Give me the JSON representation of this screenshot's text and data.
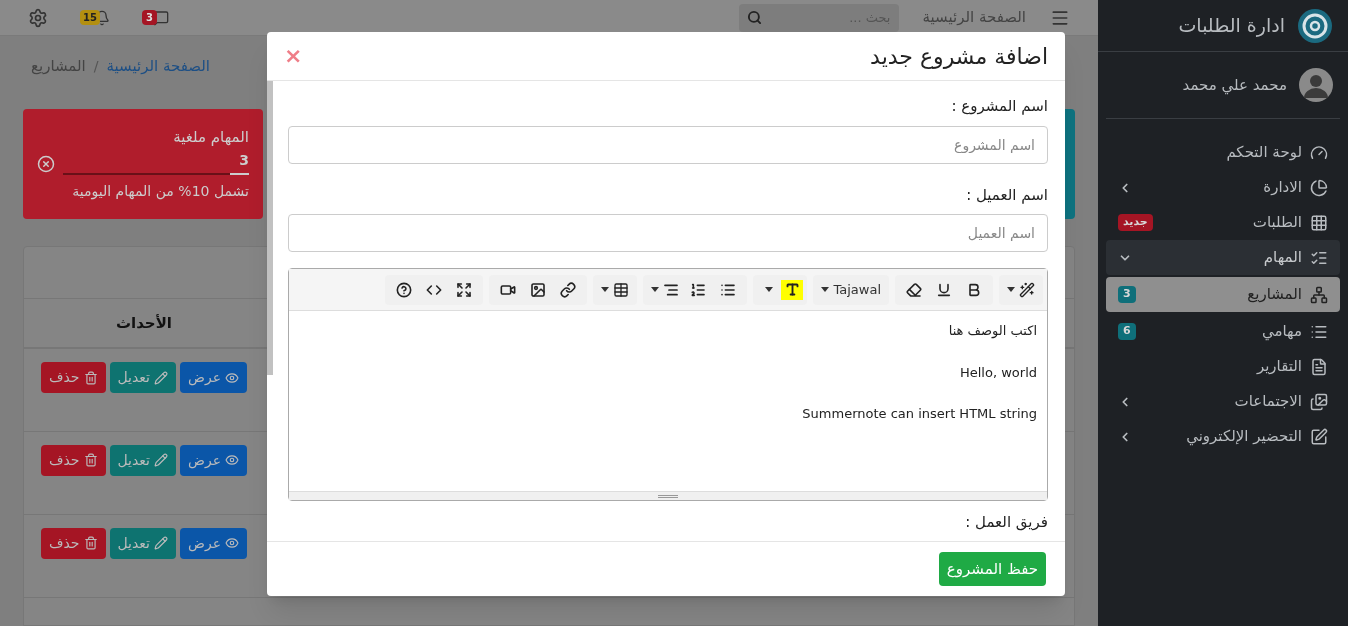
{
  "navbar": {
    "home_link": "الصفحة الرئيسية",
    "search": {
      "placeholder": "بحث ..."
    },
    "messages_count": "3",
    "notifications_count": "15"
  },
  "breadcrumb": {
    "separator": "/",
    "items": [
      {
        "label": "الصفحة الرئيسية",
        "link": true
      },
      {
        "label": "المشاريع",
        "link": false
      }
    ]
  },
  "stat_card": {
    "title": "المهام ملغية",
    "value": "3",
    "level": 0.1,
    "note": "تشمل 10% من المهام اليومية"
  },
  "table": {
    "columns": [
      "الأحداث"
    ],
    "rows": [
      {
        "actions": [
          {
            "kind": "view",
            "label": "عرض"
          },
          {
            "kind": "edit",
            "label": "تعديل"
          },
          {
            "kind": "delete",
            "label": "حذف"
          }
        ]
      },
      {
        "actions": [
          {
            "kind": "view",
            "label": "عرض"
          },
          {
            "kind": "edit",
            "label": "تعديل"
          },
          {
            "kind": "delete",
            "label": "حذف"
          }
        ]
      },
      {
        "actions": [
          {
            "kind": "view",
            "label": "عرض"
          },
          {
            "kind": "edit",
            "label": "تعديل"
          },
          {
            "kind": "delete",
            "label": "حذف"
          }
        ]
      }
    ]
  },
  "sidebar": {
    "brand": "ادارة الطلبات",
    "user": "محمد علي محمد",
    "items": [
      {
        "label": "لوحة التحكم",
        "has_submenu": false,
        "expanded": false,
        "selected": false
      },
      {
        "label": "الادارة",
        "has_submenu": true,
        "expanded": false,
        "selected": false
      },
      {
        "label": "الطلبات",
        "has_submenu": false,
        "expanded": false,
        "selected": false,
        "badge": {
          "text": "جديد",
          "color": "#a51524"
        }
      },
      {
        "label": "المهام",
        "has_submenu": true,
        "expanded": true,
        "selected": false,
        "children": [
          {
            "label": "المشاريع",
            "selected": true,
            "badge": {
              "text": "3",
              "color": "#0f6f7a"
            }
          },
          {
            "label": "مهامي",
            "selected": false,
            "badge": {
              "text": "6",
              "color": "#0f6f7a"
            }
          }
        ]
      },
      {
        "label": "التقارير",
        "has_submenu": false,
        "expanded": false,
        "selected": false
      },
      {
        "label": "الاجتماعات",
        "has_submenu": true,
        "expanded": false,
        "selected": false
      },
      {
        "label": "التحضير الإلكتروني",
        "has_submenu": true,
        "expanded": false,
        "selected": false
      }
    ]
  },
  "modal": {
    "title": "اضافة مشروع جديد",
    "close": "×",
    "fields": [
      {
        "label": "اسم المشروع :",
        "placeholder": "اسم المشروع"
      },
      {
        "label": "اسم العميل :",
        "placeholder": "اسم العميل"
      }
    ],
    "editor": {
      "font": "Tajawal",
      "paragraphs": [
        "اكتب الوصف هنا",
        "Hello, world",
        "Summernote can insert HTML string"
      ]
    },
    "next_label": "فريق العمل :",
    "save_button": "حفظ المشروع"
  }
}
